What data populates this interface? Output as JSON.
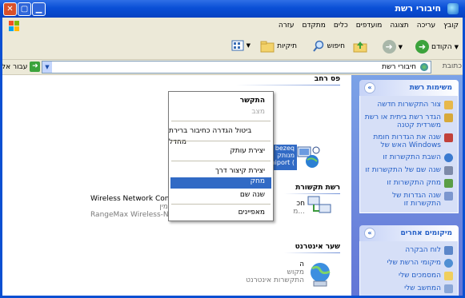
{
  "window": {
    "title": "חיבורי רשת"
  },
  "menubar": [
    "קובץ",
    "עריכה",
    "תצוגה",
    "מועדפים",
    "כלים",
    "מתקדם",
    "עזרה"
  ],
  "toolbar": {
    "back": "הקודם",
    "search": "חיפוש",
    "folders": "תיקיות"
  },
  "address": {
    "label": "כתובת",
    "value": "חיבורי רשת",
    "go": "עבור אל"
  },
  "taskpane": {
    "network_tasks": {
      "title": "משימות רשת",
      "items": [
        "צור התקשרות חדשה",
        "הגדר רשת ביתית או רשת משרדית קטנה",
        "שנה את הגדרות חומת האש של Windows",
        "השבת התקשרות זו",
        "שנה שם של התקשרות זו",
        "מחק התקשרות זו",
        "שנה הגדרות של התקשרות זו"
      ]
    },
    "other_places": {
      "title": "מיקומים אחרים",
      "items": [
        "לוח הבקרה",
        "מיקומי הרשת שלי",
        "המסמכים שלי",
        "המחשב שלי"
      ]
    }
  },
  "main": {
    "group_broadband": "פס רחב",
    "broadband_item": {
      "name": "bezeq",
      "status": "מנותק",
      "device": "WAN Miniport (PPPOE)"
    },
    "group_lan": "רשת תקשורת",
    "lan_item": {
      "name": "Wireless Network Connection",
      "status": "זמין",
      "device": "RangeMax Wireless-N USB A..."
    },
    "lan_partial": {
      "line1": "חכ",
      "line2": "מ..."
    },
    "group_internet": "שער אינטרנט",
    "internet_item": {
      "name": "ה",
      "status": "מקוש",
      "device": "התקשרות אינטרנט"
    }
  },
  "context_menu": {
    "items": [
      {
        "label": "התקשר",
        "bold": true
      },
      {
        "label": "מצב",
        "disabled": true
      },
      {
        "label": "ביטול הגדרה כחיבור ברירת מחדל"
      },
      {
        "label": "יצירת עותק"
      },
      {
        "label": "יצירת קיצור דרך"
      },
      {
        "label": "מחק",
        "highlight": true
      },
      {
        "label": "שנה שם"
      },
      {
        "label": "מאפיינים"
      }
    ]
  },
  "colors": {
    "accent": "#316ac5",
    "titlebar": "#0a4fd6",
    "pane": "#6d8ee0"
  }
}
